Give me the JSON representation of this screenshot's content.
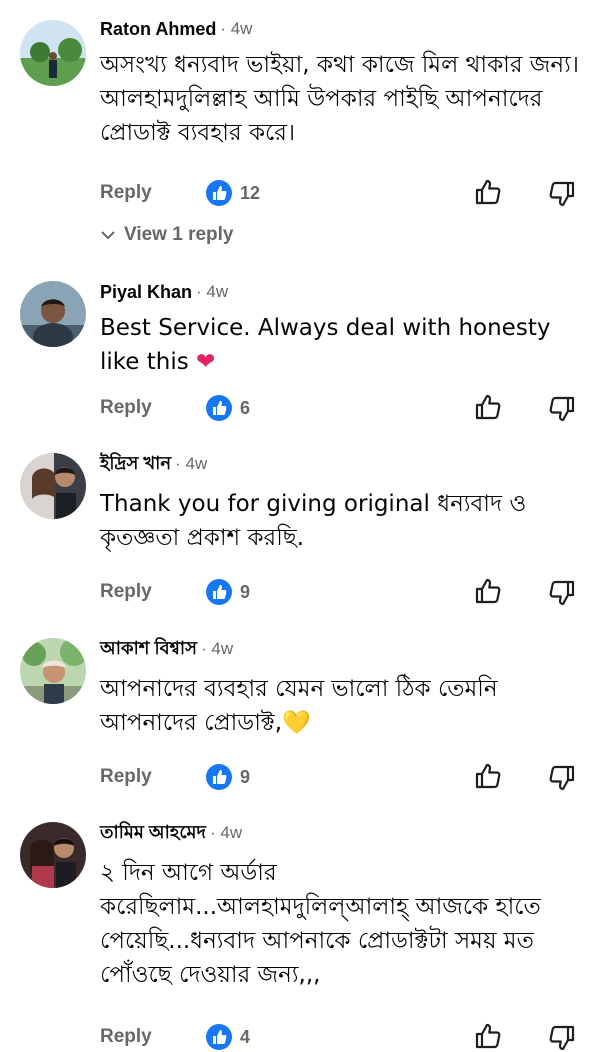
{
  "comments": [
    {
      "author": "Raton Ahmed",
      "time": "· 4w",
      "text": "অসংখ্য ধন্যবাদ ভাইয়া, কথা কাজে মিল থাকার জন্য। আলহামদুলিল্লাহ আমি উপকার পাইছি আপনাদের প্রোডাক্ট ব্যবহার করে।",
      "reply_label": "Reply",
      "like_count": "12",
      "view_replies": "View 1 reply"
    },
    {
      "author": "Piyal Khan",
      "time": "· 4w",
      "text": "Best  Service. Always deal with honesty like this",
      "emoji": "❤",
      "reply_label": "Reply",
      "like_count": "6"
    },
    {
      "author": "ইদ্রিস খান",
      "time": "· 4w",
      "text": "Thank you for giving original ধন্যবাদ ও কৃতজ্ঞতা প্রকাশ করছি.",
      "reply_label": "Reply",
      "like_count": "9"
    },
    {
      "author": "আকাশ বিশ্বাস",
      "time": "· 4w",
      "text": "আপনাদের ব্যবহার যেমন ভালো ঠিক তেমনি আপনাদের প্রোডাক্ট,",
      "emoji": "💛",
      "reply_label": "Reply",
      "like_count": "9"
    },
    {
      "author": "তামিম আহমেদ",
      "time": "· 4w",
      "text": "২ দিন আগে অর্ডার করেছিলাম...আলহামদুলিল্আলাহ্ আজকে হাতে পেয়েছি...ধন্যবাদ আপনাকে প্রোডাক্টটা সময় মত পোঁওছে দেওয়ার জন্য,,,",
      "reply_label": "Reply",
      "like_count": "4"
    }
  ],
  "icons": {
    "like_badge": "like-badge-icon",
    "thumb_up": "thumbs-up-icon",
    "thumb_down": "thumbs-down-icon",
    "chevron": "chevron-down-icon"
  },
  "colors": {
    "like_blue": "#1877f2",
    "secondary_text": "#65676b",
    "primary_text": "#050505"
  }
}
